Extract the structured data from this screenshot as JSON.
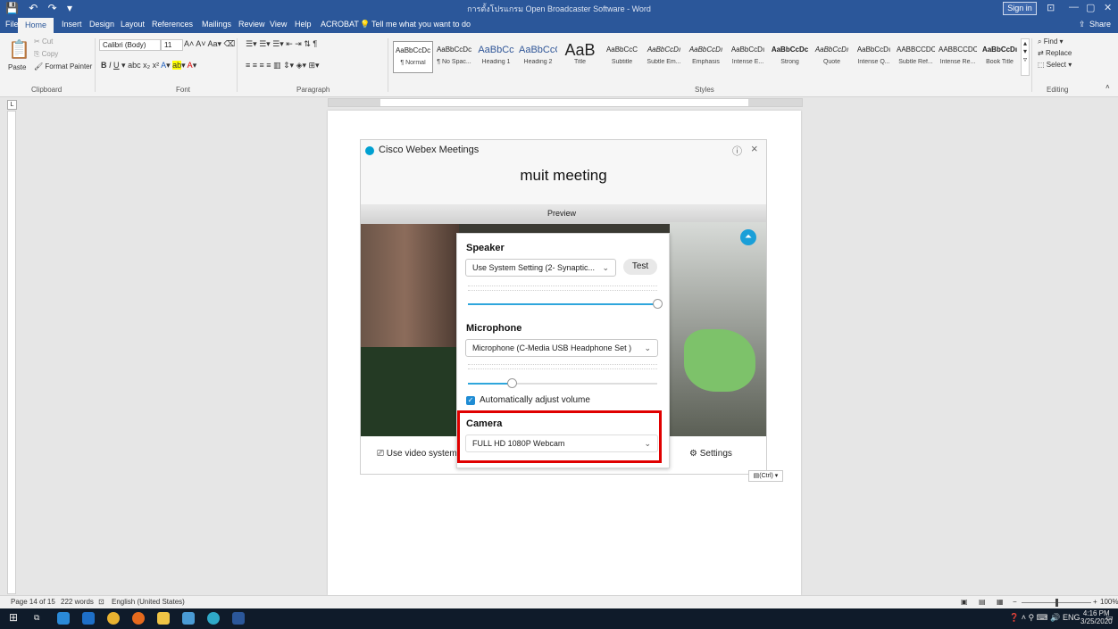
{
  "window": {
    "title": "การตั้งโปรแกรม Open Broadcaster Software - Word",
    "sign_in": "Sign in"
  },
  "tabs": [
    "File",
    "Home",
    "Insert",
    "Design",
    "Layout",
    "References",
    "Mailings",
    "Review",
    "View",
    "Help",
    "ACROBAT"
  ],
  "tell_me": "Tell me what you want to do",
  "share": "Share",
  "clipboard": {
    "paste": "Paste",
    "cut": "Cut",
    "copy": "Copy",
    "format_painter": "Format Painter",
    "label": "Clipboard"
  },
  "font": {
    "name": "Calibri (Body)",
    "size": "11",
    "label": "Font"
  },
  "paragraph": {
    "label": "Paragraph"
  },
  "styles": {
    "label": "Styles",
    "items": [
      {
        "preview": "AaBbCcDc",
        "name": "¶ Normal"
      },
      {
        "preview": "AaBbCcDc",
        "name": "¶ No Spac..."
      },
      {
        "preview": "AaBbCc",
        "name": "Heading 1"
      },
      {
        "preview": "AaBbCcC",
        "name": "Heading 2"
      },
      {
        "preview": "AaB",
        "name": "Title"
      },
      {
        "preview": "AaBbCcC",
        "name": "Subtitle"
      },
      {
        "preview": "AaBbCcDı",
        "name": "Subtle Em..."
      },
      {
        "preview": "AaBbCcDı",
        "name": "Emphasis"
      },
      {
        "preview": "AaBbCcDı",
        "name": "Intense E..."
      },
      {
        "preview": "AaBbCcDc",
        "name": "Strong"
      },
      {
        "preview": "AaBbCcDı",
        "name": "Quote"
      },
      {
        "preview": "AaBbCcDı",
        "name": "Intense Q..."
      },
      {
        "preview": "AABBCCDC",
        "name": "Subtle Ref..."
      },
      {
        "preview": "AABBCCDC",
        "name": "Intense Re..."
      },
      {
        "preview": "AaBbCcDı",
        "name": "Book Title"
      }
    ]
  },
  "editing": {
    "find": "Find",
    "replace": "Replace",
    "select": "Select",
    "label": "Editing"
  },
  "webex": {
    "app_title": "Cisco Webex Meetings",
    "meeting_title": "muit meeting",
    "preview_label": "Preview",
    "use_video_system": "Use video system",
    "settings": "Settings"
  },
  "audio": {
    "speaker_label": "Speaker",
    "speaker_value": "Use System Setting (2- Synaptic...",
    "test": "Test",
    "microphone_label": "Microphone",
    "microphone_value": "Microphone (C-Media USB Headphone Set  )",
    "auto_adjust": "Automatically adjust volume",
    "speaker_volume": 1.0,
    "mic_volume": 0.23,
    "camera_label": "Camera",
    "camera_value": "FULL HD 1080P Webcam"
  },
  "paste_badge": "(Ctrl) ▾",
  "status": {
    "page": "Page 14 of 15",
    "words": "222 words",
    "language": "English (United States)",
    "zoom": "100%"
  },
  "taskbar": {
    "time": "4:16 PM",
    "date": "3/25/2020",
    "lang": "ENG"
  }
}
